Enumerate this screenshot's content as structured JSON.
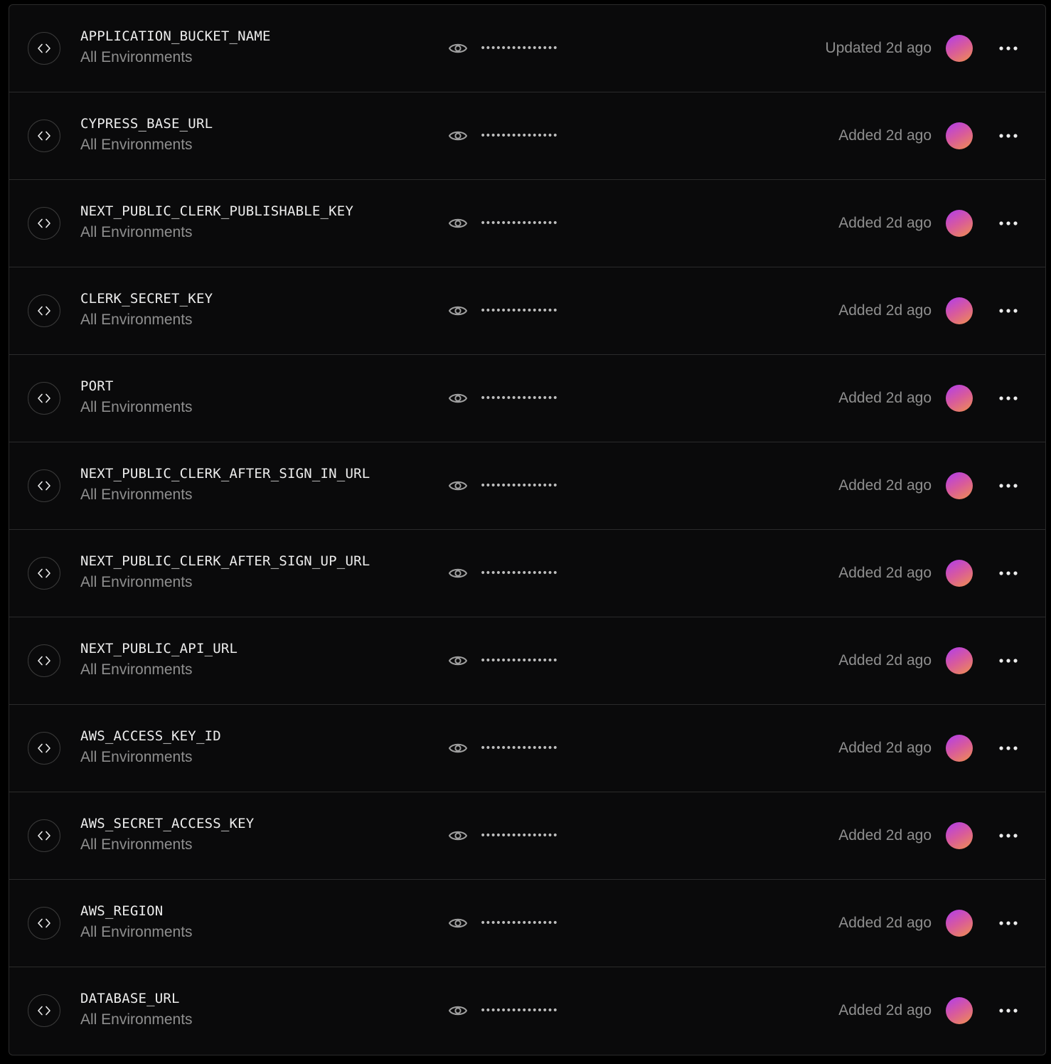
{
  "variables": [
    {
      "name": "APPLICATION_BUCKET_NAME",
      "environment": "All Environments",
      "value_masked": "•••••••••••••••",
      "status": "Updated 2d ago"
    },
    {
      "name": "CYPRESS_BASE_URL",
      "environment": "All Environments",
      "value_masked": "•••••••••••••••",
      "status": "Added 2d ago"
    },
    {
      "name": "NEXT_PUBLIC_CLERK_PUBLISHABLE_KEY",
      "environment": "All Environments",
      "value_masked": "•••••••••••••••",
      "status": "Added 2d ago"
    },
    {
      "name": "CLERK_SECRET_KEY",
      "environment": "All Environments",
      "value_masked": "•••••••••••••••",
      "status": "Added 2d ago"
    },
    {
      "name": "PORT",
      "environment": "All Environments",
      "value_masked": "•••••••••••••••",
      "status": "Added 2d ago"
    },
    {
      "name": "NEXT_PUBLIC_CLERK_AFTER_SIGN_IN_URL",
      "environment": "All Environments",
      "value_masked": "•••••••••••••••",
      "status": "Added 2d ago"
    },
    {
      "name": "NEXT_PUBLIC_CLERK_AFTER_SIGN_UP_URL",
      "environment": "All Environments",
      "value_masked": "•••••••••••••••",
      "status": "Added 2d ago"
    },
    {
      "name": "NEXT_PUBLIC_API_URL",
      "environment": "All Environments",
      "value_masked": "•••••••••••••••",
      "status": "Added 2d ago"
    },
    {
      "name": "AWS_ACCESS_KEY_ID",
      "environment": "All Environments",
      "value_masked": "•••••••••••••••",
      "status": "Added 2d ago"
    },
    {
      "name": "AWS_SECRET_ACCESS_KEY",
      "environment": "All Environments",
      "value_masked": "•••••••••••••••",
      "status": "Added 2d ago"
    },
    {
      "name": "AWS_REGION",
      "environment": "All Environments",
      "value_masked": "•••••••••••••••",
      "status": "Added 2d ago"
    },
    {
      "name": "DATABASE_URL",
      "environment": "All Environments",
      "value_masked": "•••••••••••••••",
      "status": "Added 2d ago"
    }
  ],
  "icons": {
    "row_icon": "code-brackets-icon",
    "reveal": "eye-icon",
    "menu": "more-horizontal-icon",
    "avatar": "user-avatar"
  },
  "colors": {
    "background": "#0a0a0b",
    "border": "#2b2b2b",
    "text_primary": "#ededed",
    "text_secondary": "#8f8f8f",
    "avatar_gradient": [
      "#b03cf0",
      "#d85a9c",
      "#f0904e"
    ]
  }
}
